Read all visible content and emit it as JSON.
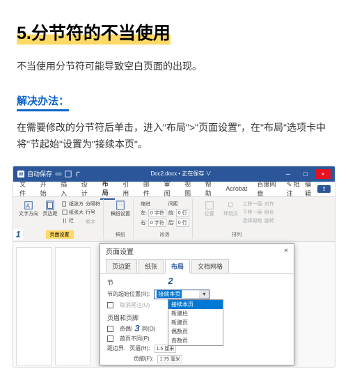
{
  "article": {
    "title": "5.分节符的不当使用",
    "intro": "不当使用分节符可能导致空白页面的出现。",
    "solution_heading": "解决办法：",
    "solution_body": "在需要修改的分节符后单击，进入\"布局\">\"页面设置\"，在\"布局\"选项卡中将\"节起始\"设置为\"接续本页\"。"
  },
  "badges": {
    "n1": "1",
    "n2": "2",
    "n3": "3"
  },
  "word": {
    "autosave": "自动保存",
    "doc_title": "Doc2.docx • 正在保存 ∨",
    "tabs": [
      "文件",
      "开始",
      "插入",
      "设计",
      "布局",
      "引用",
      "邮件",
      "审阅",
      "视图",
      "帮助",
      "Acrobat",
      "百度网盘"
    ],
    "active_tab": "布局",
    "comment_btn": "批注",
    "edit_btn": "编辑",
    "ribbon": {
      "textdir": "文字方向",
      "margins": "页边距",
      "size": "纸张大",
      "orient": "纸张方",
      "cols": "栏",
      "breaks": "分隔符",
      "linenum": "行号",
      "hyphen": "断字",
      "group_page": "页面设置",
      "paper": "稿纸设置",
      "group_paper": "稿纸",
      "indent": "缩进",
      "spacing": "间距",
      "left": "左:",
      "right": "右:",
      "before": "前:",
      "after": "后:",
      "zero_ch": "0 字符",
      "zero_ln": "0 行",
      "group_para": "段落",
      "pos": "位置",
      "wrap": "环绕文",
      "forward": "上移一层",
      "backward": "下移一层",
      "selpane": "选择窗格",
      "align": "对齐",
      "group": "组合",
      "rotate": "旋转",
      "group_arr": "排列"
    }
  },
  "dialog": {
    "title": "页面设置",
    "tabs": [
      "页边距",
      "纸张",
      "布局",
      "文档网格"
    ],
    "active": "布局",
    "section": "节",
    "start_label": "节的起始位置(R):",
    "start_value": "接续本页",
    "suppress": "取消尾注(U)",
    "dropdown": [
      "接续本页",
      "新建栏",
      "新建页",
      "偶数页",
      "奇数页"
    ],
    "hdr_section": "页眉和页脚",
    "odd_even": "奇偶页不同(O)",
    "first_diff": "首页不同(P)",
    "from_edge": "距边界:",
    "header": "页眉(H):",
    "footer": "页脚(F):",
    "h_val": "1.5 厘米",
    "f_val": "1.75 厘米"
  }
}
